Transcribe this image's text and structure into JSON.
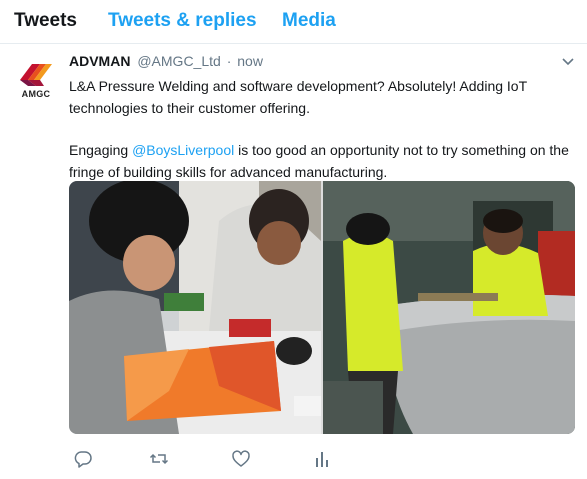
{
  "tabs": {
    "tweets": "Tweets",
    "tweets_replies": "Tweets & replies",
    "media": "Media"
  },
  "tweet": {
    "avatar_text": "AMGC",
    "display_name": "ADVMAN",
    "handle": "@AMGC_Ltd",
    "separator": "·",
    "time": "now",
    "paragraph1": "L&A Pressure Welding and software development? Absolutely! Adding IoT technologies to their customer offering.",
    "paragraph2_prefix": "Engaging ",
    "mention": "@BoysLiverpool",
    "paragraph2_suffix": " is too good an opportunity not to try something on the fringe of building skills for advanced manufacturing."
  },
  "colors": {
    "accent": "#1da1f2",
    "text": "#14171a",
    "muted": "#657786",
    "border": "#e6ecf0",
    "hi_vis": "#d6ea2a"
  },
  "icons": {
    "reply": "speech-bubble-icon",
    "retweet": "retweet-arrows-icon",
    "like": "heart-icon",
    "analytics": "bar-chart-icon",
    "menu": "chevron-down-icon"
  }
}
